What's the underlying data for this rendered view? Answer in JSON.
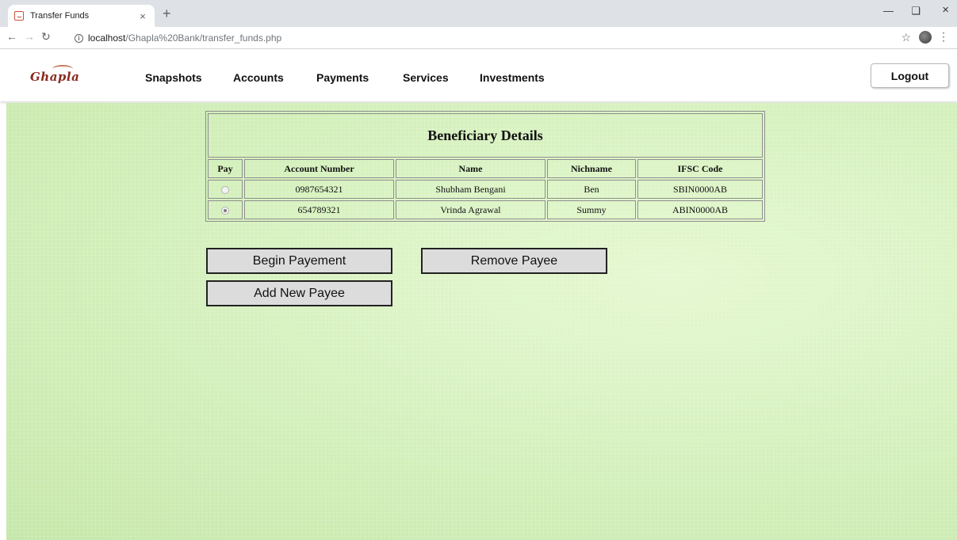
{
  "browser": {
    "tab_title": "Transfer Funds",
    "tab_close": "×",
    "new_tab": "+",
    "url_host": "localhost",
    "url_path": "/Ghapla%20Bank/transfer_funds.php"
  },
  "header": {
    "logo_text": "Ghapla",
    "nav": [
      "Snapshots",
      "Accounts",
      "Payments",
      "Services",
      "Investments"
    ],
    "logout_label": "Logout"
  },
  "beneficiary_table": {
    "title": "Beneficiary Details",
    "columns": [
      "Pay",
      "Account Number",
      "Name",
      "Nichname",
      "IFSC Code"
    ],
    "rows": [
      {
        "selected": false,
        "account_number": "0987654321",
        "name": "Shubham Bengani",
        "nickname": "Ben",
        "ifsc": "SBIN0000AB"
      },
      {
        "selected": true,
        "account_number": "654789321",
        "name": "Vrinda Agrawal",
        "nickname": "Summy",
        "ifsc": "ABIN0000AB"
      }
    ]
  },
  "actions": {
    "begin_payment": "Begin Payement",
    "remove_payee": "Remove Payee",
    "add_new_payee": "Add New Payee"
  },
  "icons": {
    "back": "arrow-left-icon",
    "forward": "arrow-right-icon",
    "reload": "reload-icon",
    "info": "info-icon",
    "star": "star-icon",
    "profile": "profile-avatar-icon",
    "menu": "kebab-menu-icon"
  },
  "colors": {
    "content_bg": "#d4f0bc",
    "logo_color": "#8b2a20",
    "button_bg": "#dcdcdc"
  }
}
